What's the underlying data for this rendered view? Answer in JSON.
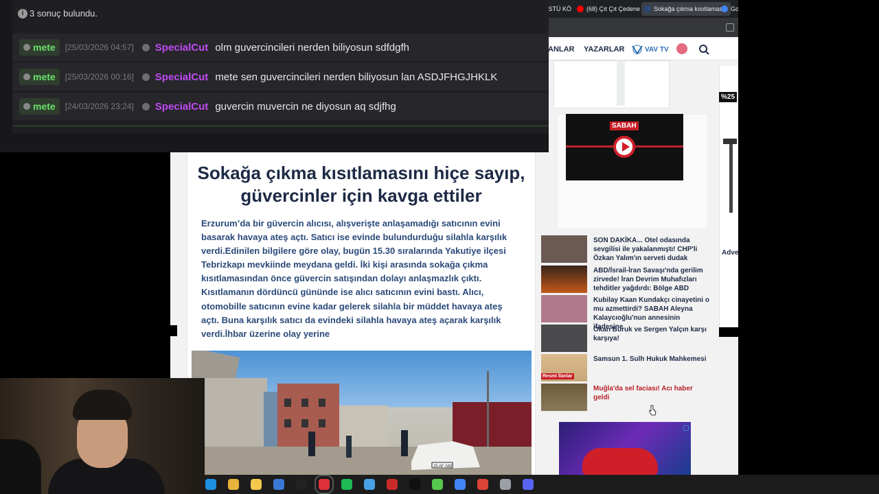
{
  "chat": {
    "result_text": "3 sonuç bulundu.",
    "messages": [
      {
        "user_badge": "mete",
        "timestamp": "[25/03/2026 04:57]",
        "author": "SpecialCut",
        "text": "olm guvercincileri nerden biliyosun sdfdgfh"
      },
      {
        "user_badge": "mete",
        "timestamp": "[25/03/2026 00:16]",
        "author": "SpecialCut",
        "text": "mete sen guvercincileri nerden biliyosun lan ASDJFHGJHKLK"
      },
      {
        "user_badge": "mete",
        "timestamp": "[24/03/2026 23:24]",
        "author": "SpecialCut",
        "text": "guvercin muvercin ne diyosun aq sdjfhg"
      }
    ]
  },
  "browser": {
    "tabs": [
      {
        "label": "ÜSTÜ KÖ",
        "icon_color": "#3c4043"
      },
      {
        "label": "(68) Çıt Çıt Çedene -",
        "icon_color": "#ff0000"
      },
      {
        "label": "Sokağa çıkma kısıtlamasın",
        "icon_color": "#2b4a7a"
      },
      {
        "label": "Goo",
        "icon_color": "#4285f4"
      }
    ],
    "nav": {
      "item1": "ANLAR",
      "item2": "YAZARLAR",
      "vavtv": "VAV TV",
      "search_icon": "search-icon"
    }
  },
  "article": {
    "title": "Sokağa çıkma kısıtlamasını hiçe sayıp, güvercinler için kavga ettiler",
    "lead": "Erzurum’da bir güvercin alıcısı, alışverişte anlaşamadığı satıcının evini basarak havaya ateş açtı. Satıcı ise evinde bulundurduğu silahla karşılık verdi.Edinilen bilgilere göre olay, bugün 15.30 sıralarında Yakutiye ilçesi Tebrizkapı mevkiinde meydana geldi. İki kişi arasında sokağa çıkma kısıtlamasından önce güvercin satışından dolayı anlaşmazlık çıktı. Kısıtlamanın dördüncü gününde ise alıcı satıcının evini bastı. Alıcı, otomobille satıcının evine kadar gelerek silahla bir müddet havaya ateş açtı. Buna karşılık satıcı da evindeki silahla havaya ateş açarak karşılık verdi.İhbar üzerine olay yerine",
    "plate": "25 AF 040"
  },
  "sidebar": {
    "video_badge": "SABAH",
    "news": [
      {
        "text": "SON DAKİKA... Otel odasında sevgilisi ile yakalanmıştı! CHP'li Özkan Yalım'ın serveti dudak",
        "thumb": "#6a5a52",
        "red": false
      },
      {
        "text": "ABD/İsrail-İran Savaşı'nda gerilim zirvede! İran Devrim Muhafızları tehditler yağdırdı: Bölge ABD",
        "thumb": "#8a4a2a",
        "red": false
      },
      {
        "text": "Kubilay Kaan Kundakçı cinayetini o mu azmettirdi? SABAH Aleyna Kalaycıoğlu'nun annesinin ifadesine",
        "thumb": "#b07a8c",
        "red": false
      },
      {
        "text": "Okan Buruk ve Sergen Yalçın karşı karşıya!",
        "thumb": "#4a4a4e",
        "red": false
      },
      {
        "text": "Samsun 1. Sulh Hukuk Mahkemesi",
        "thumb": "#b8a07a",
        "red": false
      },
      {
        "text": "Muğla'da sel faciası! Acı haber geldi",
        "thumb": "#6d5a3a",
        "red": true
      }
    ],
    "resmi_label": "Resmi İlanlar",
    "right_ad_pct": "%25",
    "right_ad_text": "Adve"
  },
  "taskbar": {
    "icons": [
      {
        "name": "edge-icon",
        "color": "#1f8fe0"
      },
      {
        "name": "file-explorer-icon",
        "color": "#e8b33a"
      },
      {
        "name": "microsoft-store-icon",
        "color": "#f2c94c"
      },
      {
        "name": "mail-icon",
        "color": "#3a78d6"
      },
      {
        "name": "snipping-tool-icon",
        "color": "#222"
      },
      {
        "name": "opera-gx-icon",
        "color": "#e0303a"
      },
      {
        "name": "spotify-icon",
        "color": "#1db954"
      },
      {
        "name": "app-icon",
        "color": "#4aa0e6"
      },
      {
        "name": "game-icon",
        "color": "#c92a2a"
      },
      {
        "name": "terminal-icon",
        "color": "#101010"
      },
      {
        "name": "nvidia-icon",
        "color": "#57c84d"
      },
      {
        "name": "chrome-icon",
        "color": "#4285f4"
      },
      {
        "name": "chrome-icon-2",
        "color": "#db4437"
      },
      {
        "name": "tool-icon",
        "color": "#9aa0a6"
      },
      {
        "name": "discord-icon",
        "color": "#5865f2"
      }
    ]
  },
  "colors": {
    "chat_user": "#c04cf2",
    "chat_badge": "#6be26b",
    "headline": "#1d2a45"
  }
}
